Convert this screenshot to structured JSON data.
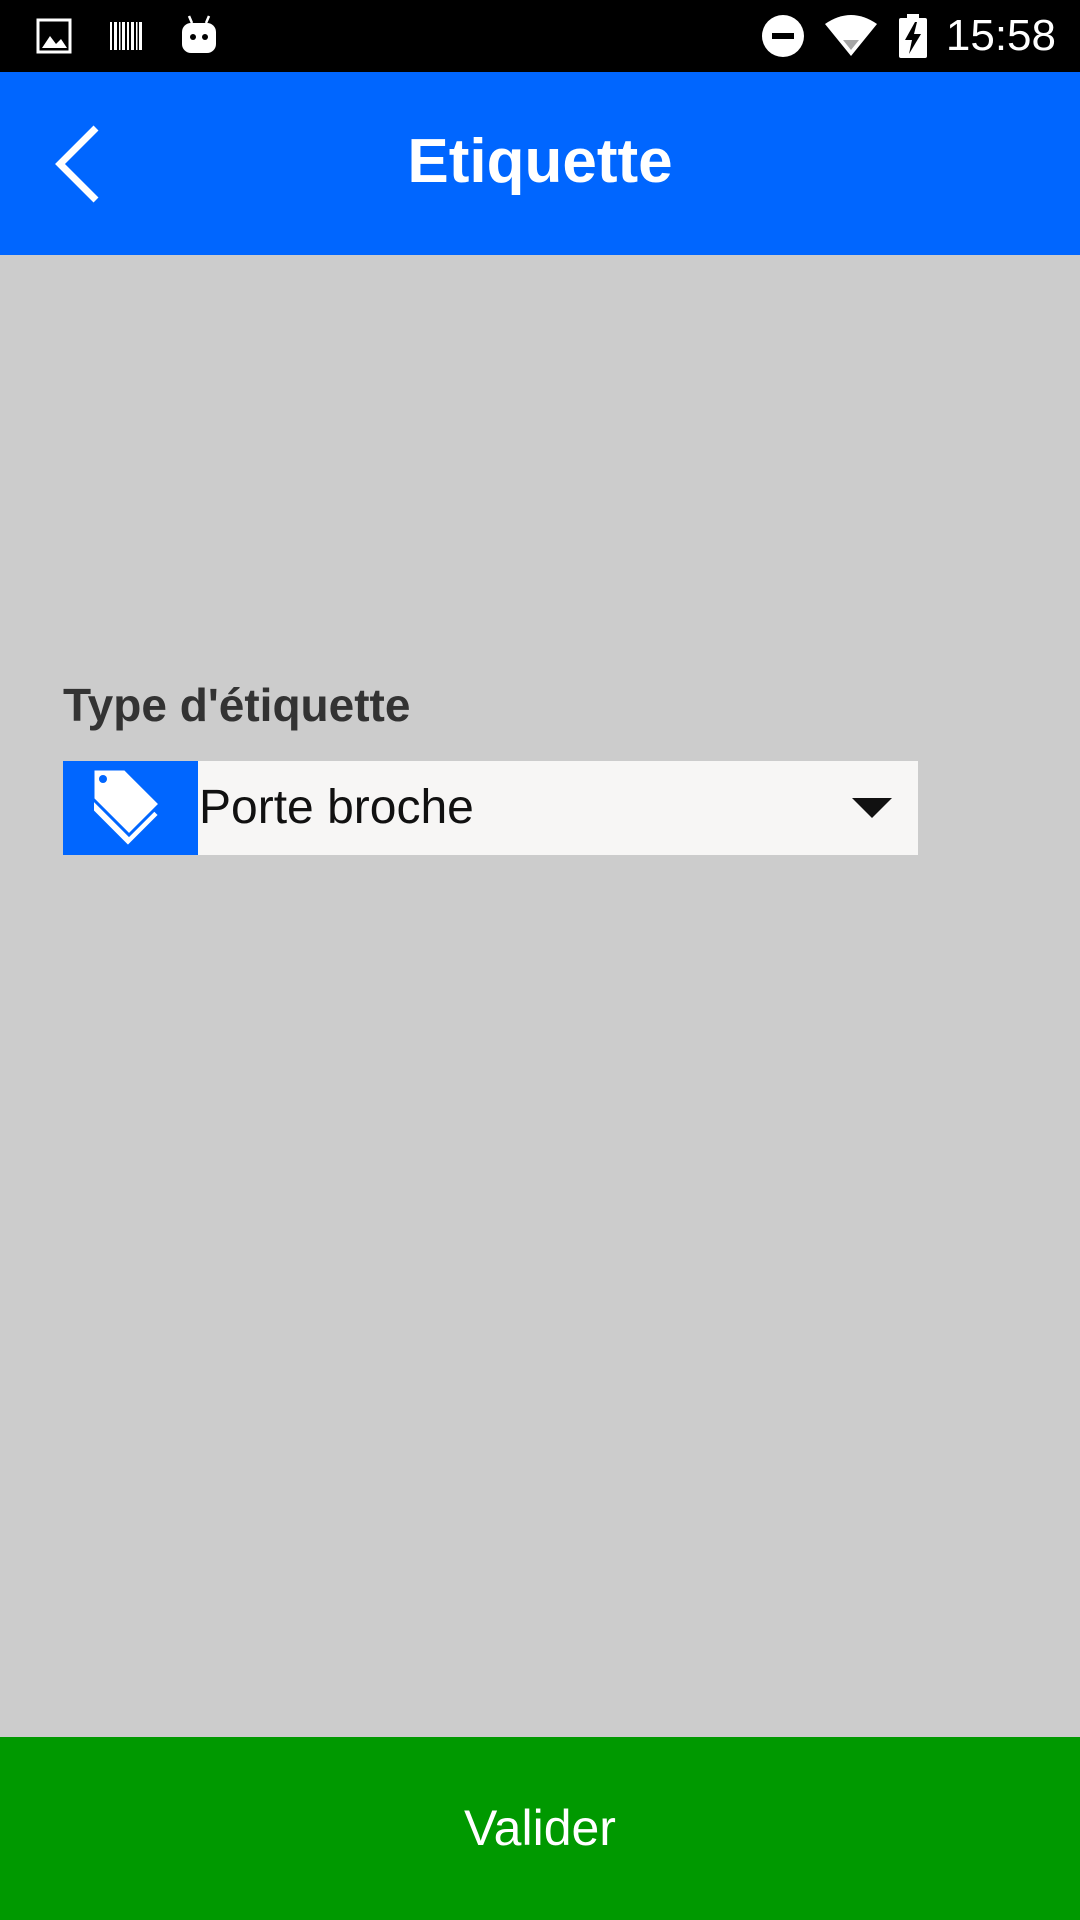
{
  "status_bar": {
    "time": "15:58",
    "left_icons": [
      "gallery-icon",
      "barcode-icon",
      "android-robot-icon"
    ],
    "right_icons": [
      "do-not-disturb-icon",
      "wifi-icon",
      "battery-charging-icon"
    ]
  },
  "app_bar": {
    "title": "Etiquette",
    "background_color": "#0066ff",
    "back_icon": "chevron-left-icon"
  },
  "form": {
    "label_type": "Type d'étiquette",
    "label_type_selected": "Porte broche",
    "spinner_icon": "tag-icon",
    "spinner_icon_bg": "#0066ff"
  },
  "footer": {
    "validate_label": "Valider",
    "validate_color": "#009900"
  }
}
